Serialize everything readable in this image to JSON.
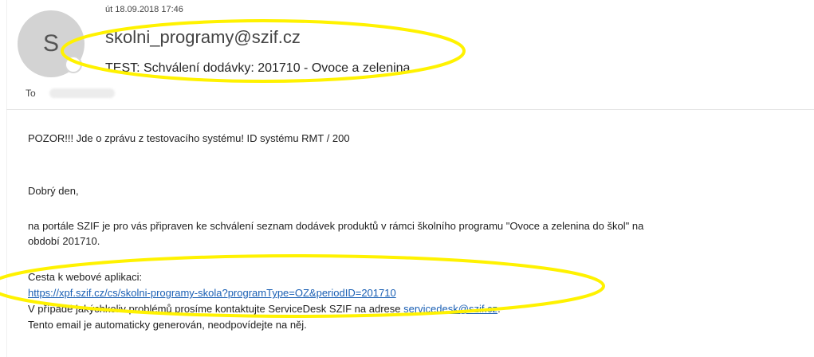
{
  "header": {
    "avatar_initial": "S",
    "timestamp": "út 18.09.2018 17:46",
    "sender": "skolni_programy@szif.cz",
    "subject": "TEST: Schválení dodávky: 201710 - Ovoce a zelenina",
    "to_label": "To",
    "recipient": "redacted"
  },
  "message": {
    "warning": "POZOR!!! Jde o zprávu z testovacího systému! ID systému RMT / 200",
    "greeting": "Dobrý den,",
    "para1_line1": "na portále SZIF je pro vás připraven ke schválení seznam dodávek produktů v rámci školního programu \"Ovoce a zelenina do škol\" na",
    "para1_line2": "období 201710.",
    "path_label": "Cesta k webové aplikaci:",
    "app_link": "https://xpf.szif.cz/cs/skolni-programy-skola?programType=OZ&periodID=201710",
    "support_prefix": "V případě jakýchkoliv problémů prosíme kontaktujte ServiceDesk SZIF na adrese ",
    "support_email": "servicedesk@szif.cz",
    "support_suffix": ".",
    "auto_note": "Tento email je automaticky generován, neodpovídejte na něj."
  },
  "annotation_color": "#fff200"
}
